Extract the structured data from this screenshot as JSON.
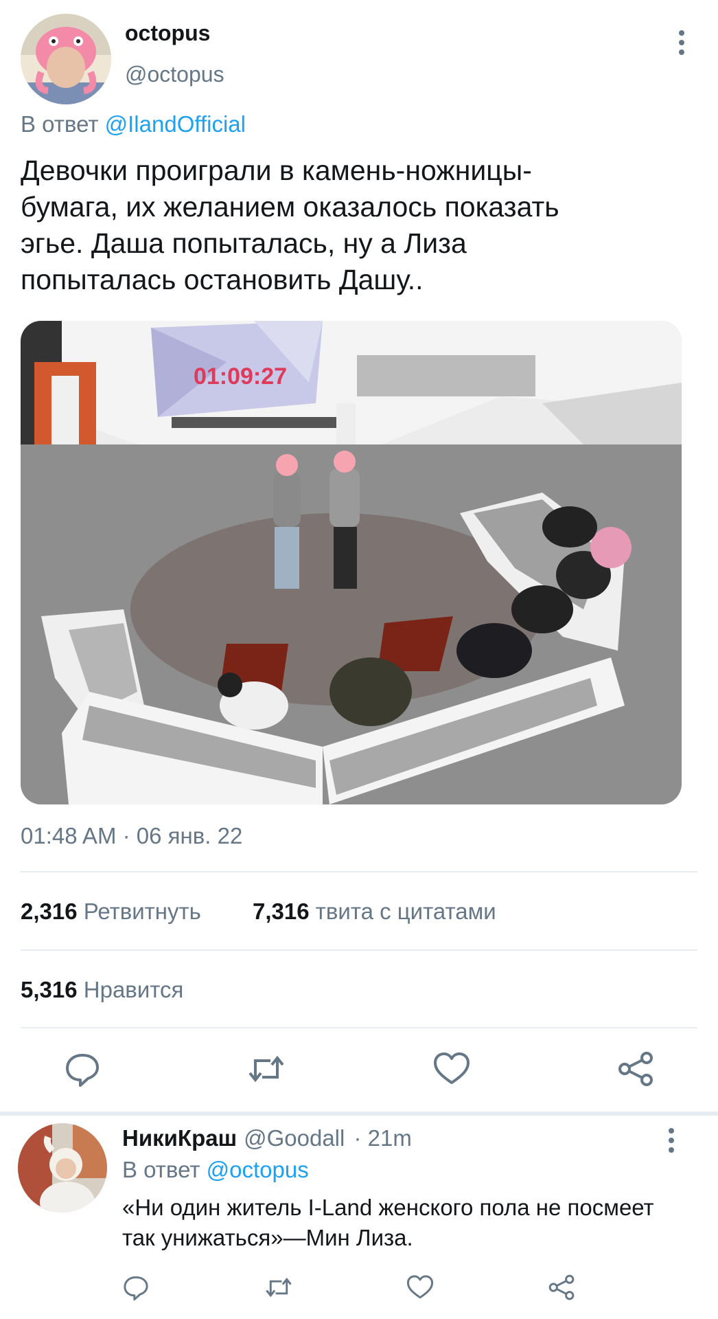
{
  "tweet": {
    "author_name": "octopus",
    "author_handle": "@octopus",
    "reply_prefix": "В ответ",
    "reply_mention": "@IlandOfficial",
    "text": "Девочки проиграли в камень-ножницы-\nбумага, их желанием оказалось показать\nэгье. Даша попыталась, ну а Лиза\nпопыталась остановить Дашу..",
    "media_timer": "01:09:27",
    "timestamp": "01:48 AM · 06 янв. 22",
    "retweets_count": "2,316",
    "retweets_label": "Ретвитнуть",
    "quotes_count": "7,316",
    "quotes_label": "твита с цитатами",
    "likes_count": "5,316",
    "likes_label": "Нравится",
    "actions": [
      "reply-icon",
      "retweet-icon",
      "like-icon",
      "share-icon"
    ]
  },
  "reply": {
    "author_name": "НикиКраш",
    "author_handle": "@Goodall",
    "time": "· 21m",
    "reply_prefix": "В ответ",
    "reply_mention": "@octopus",
    "text": "«Ни один житель I-Land женского пола не посмеет так унижаться»—Мин Лиза.",
    "actions": [
      "reply-icon",
      "retweet-icon",
      "like-icon",
      "share-icon"
    ]
  },
  "colors": {
    "accent": "#1da1f2",
    "secondary_text": "#657786",
    "primary_text": "#14171a",
    "divider": "#e6ecf0"
  }
}
